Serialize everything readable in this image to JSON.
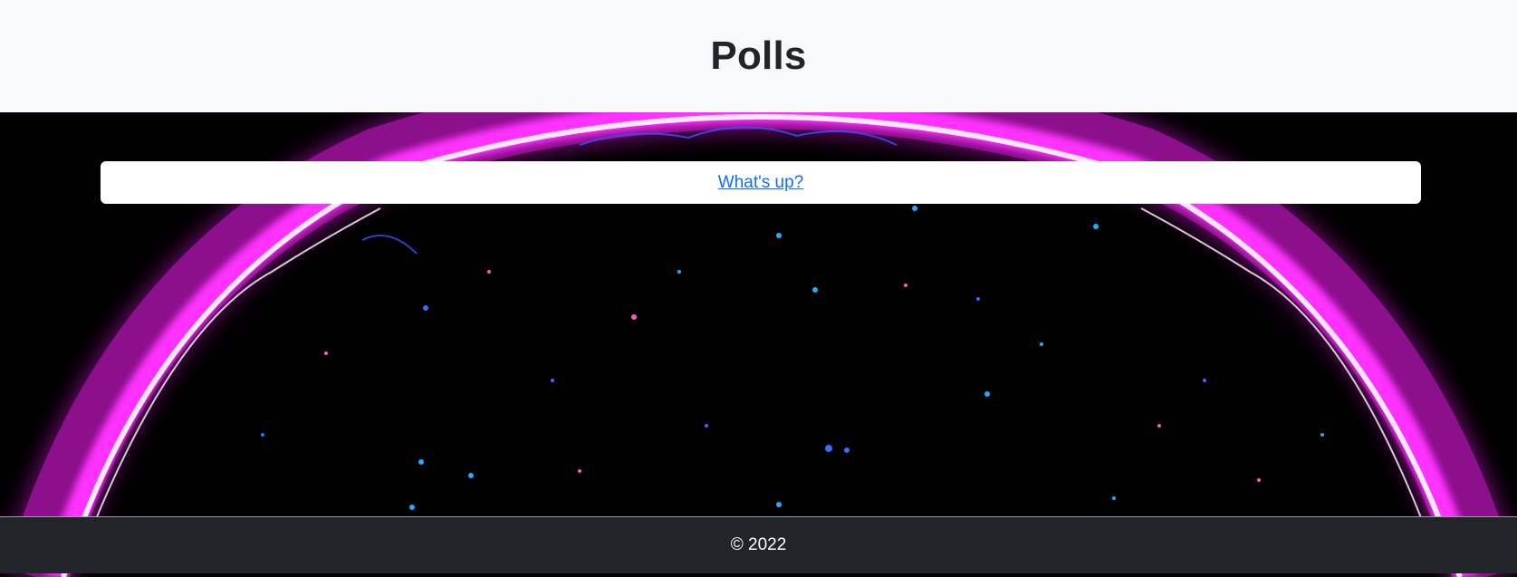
{
  "header": {
    "title": "Polls"
  },
  "polls": [
    {
      "question": "What's up?"
    }
  ],
  "footer": {
    "text": "© 2022"
  },
  "colors": {
    "header_bg": "#f8f9fa",
    "footer_bg": "#212529",
    "link": "#0d6efd",
    "glow": "#ff22ff"
  }
}
